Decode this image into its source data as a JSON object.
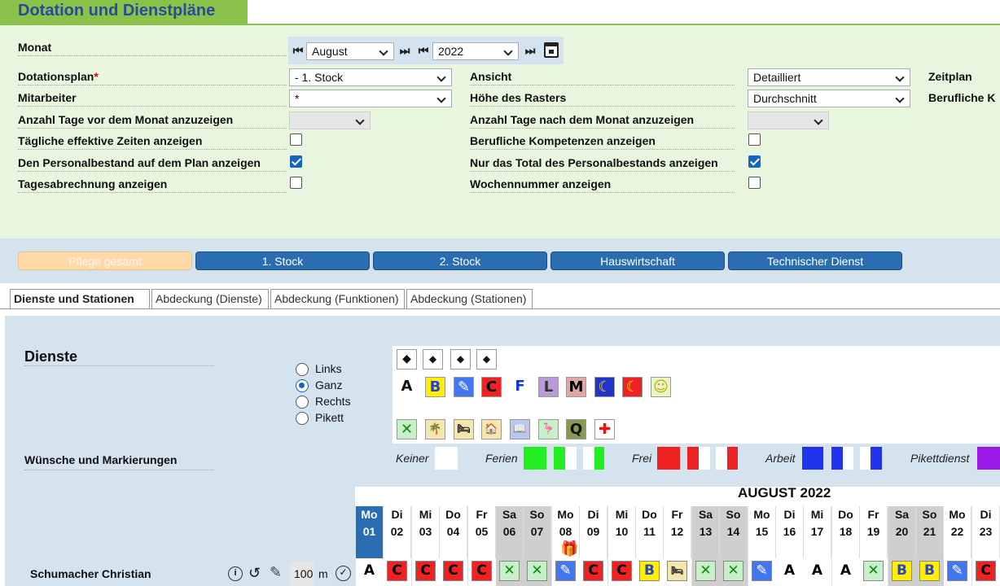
{
  "title": "Dotation und Dienstpläne",
  "filters": {
    "monat_label": "Monat",
    "month_value": "August",
    "year_value": "2022",
    "dotationsplan_label": "Dotationsplan",
    "dotationsplan_value": "- 1. Stock",
    "mitarbeiter_label": "Mitarbeiter",
    "mitarbeiter_value": "*",
    "tage_vor_label": "Anzahl Tage vor dem Monat anzuzeigen",
    "eff_zeiten_label": "Tägliche effektive Zeiten anzeigen",
    "personalbestand_label": "Den Personalbestand auf dem Plan anzeigen",
    "tagesabrechnung_label": "Tagesabrechnung anzeigen",
    "ansicht_label": "Ansicht",
    "ansicht_value": "Detailliert",
    "hoehe_label": "Höhe des Rasters",
    "hoehe_value": "Durchschnitt",
    "tage_nach_label": "Anzahl Tage nach dem Monat anzuzeigen",
    "kompetenzen_label": "Berufliche Kompetenzen anzeigen",
    "total_label": "Nur das Total des Personalbestands anzeigen",
    "wochennummer_label": "Wochennummer anzeigen",
    "zeitplan_label": "Zeitplan",
    "berufliche_k_label": "Berufliche K",
    "checks": {
      "eff_zeiten": false,
      "personalbestand": true,
      "tagesabrechnung": false,
      "kompetenzen": false,
      "total": true,
      "wochennummer": false
    }
  },
  "groups": [
    "Pflege gesamt",
    "1. Stock",
    "2. Stock",
    "Hauswirtschaft",
    "Technischer Dienst"
  ],
  "tabs": [
    "Dienste und Stationen",
    "Abdeckung (Dienste)",
    "Abdeckung (Funktionen)",
    "Abdeckung (Stationen)"
  ],
  "dienste": {
    "heading": "Dienste",
    "wuensche_label": "Wünsche und Markierungen",
    "radio_options": [
      "Links",
      "Ganz",
      "Rechts",
      "Pikett"
    ],
    "radio_selected": "Ganz",
    "codes": [
      "A",
      "B",
      "✎",
      "C",
      "F",
      "L",
      "M",
      "☾",
      "☾",
      "☺"
    ],
    "symbols_row2": [
      "✕",
      "🌴",
      "🛏",
      "🏠",
      "📖",
      "🦩",
      "Q",
      "✚"
    ],
    "legend": {
      "keiner": "Keiner",
      "ferien": "Ferien",
      "frei": "Frei",
      "arbeit": "Arbeit",
      "pikett": "Pikettdienst"
    },
    "colors": {
      "ferien": "#22ee22",
      "frei": "#ee2222",
      "arbeit": "#2233ee",
      "pikett": "#9b19e6"
    }
  },
  "calendar": {
    "month_title": "AUGUST 2022",
    "days": [
      {
        "wd": "Mo",
        "d": "01"
      },
      {
        "wd": "Di",
        "d": "02"
      },
      {
        "wd": "Mi",
        "d": "03"
      },
      {
        "wd": "Do",
        "d": "04"
      },
      {
        "wd": "Fr",
        "d": "05"
      },
      {
        "wd": "Sa",
        "d": "06"
      },
      {
        "wd": "So",
        "d": "07"
      },
      {
        "wd": "Mo",
        "d": "08"
      },
      {
        "wd": "Di",
        "d": "09"
      },
      {
        "wd": "Mi",
        "d": "10"
      },
      {
        "wd": "Do",
        "d": "11"
      },
      {
        "wd": "Fr",
        "d": "12"
      },
      {
        "wd": "Sa",
        "d": "13"
      },
      {
        "wd": "So",
        "d": "14"
      },
      {
        "wd": "Mo",
        "d": "15"
      },
      {
        "wd": "Di",
        "d": "16"
      },
      {
        "wd": "Mi",
        "d": "17"
      },
      {
        "wd": "Do",
        "d": "18"
      },
      {
        "wd": "Fr",
        "d": "19"
      },
      {
        "wd": "Sa",
        "d": "20"
      },
      {
        "wd": "So",
        "d": "21"
      },
      {
        "wd": "Mo",
        "d": "22"
      },
      {
        "wd": "Di",
        "d": "23"
      }
    ],
    "employee": {
      "name": "Schumacher Christian",
      "pensum": "100",
      "pensum_unit": "m",
      "shifts": [
        "A",
        "C",
        "C",
        "C",
        "C",
        "✕",
        "✕",
        "✎",
        "C",
        "C",
        "B",
        "🛏",
        "✕",
        "✕",
        "✎",
        "A",
        "A",
        "A",
        "✕",
        "B",
        "B",
        "✎",
        "C"
      ]
    }
  }
}
